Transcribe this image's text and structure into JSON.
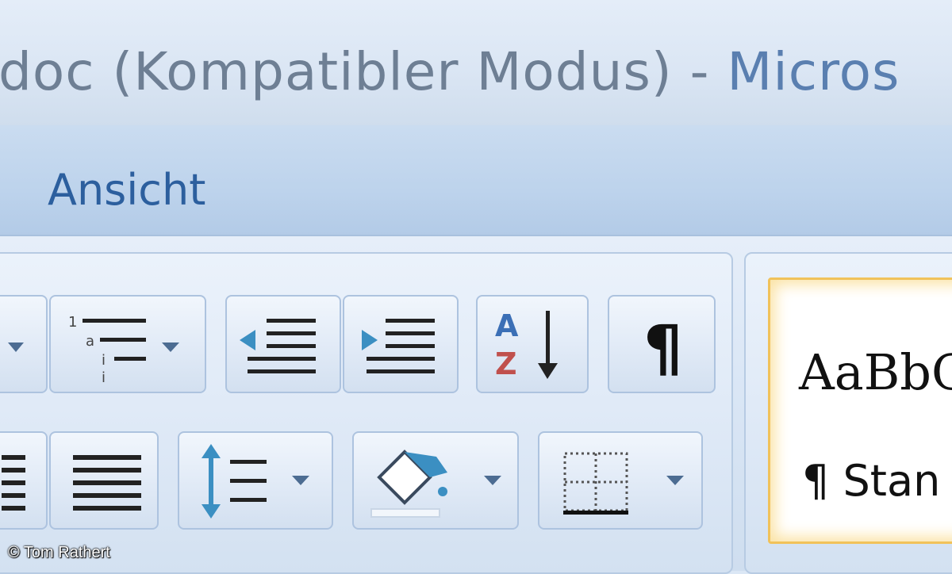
{
  "window": {
    "title_doc": "doc (Kompatibler Modus) - ",
    "title_app": "Micros"
  },
  "tabs": {
    "ansicht": "Ansicht"
  },
  "paragraph_group": {
    "buttons": [
      {
        "name": "bullets-dropdown",
        "icon": "chevron-down-icon"
      },
      {
        "name": "multilevel-list",
        "icon": "multilevel-list-icon"
      },
      {
        "name": "decrease-indent",
        "icon": "decrease-indent-icon"
      },
      {
        "name": "increase-indent",
        "icon": "increase-indent-icon"
      },
      {
        "name": "sort",
        "icon": "sort-az-icon",
        "letters": [
          "A",
          "Z"
        ]
      },
      {
        "name": "show-formatting-marks",
        "icon": "pilcrow-icon",
        "glyph": "¶"
      },
      {
        "name": "align-right",
        "icon": "align-right-icon"
      },
      {
        "name": "justify",
        "icon": "justify-icon"
      },
      {
        "name": "line-spacing",
        "icon": "line-spacing-icon"
      },
      {
        "name": "shading",
        "icon": "paint-bucket-icon"
      },
      {
        "name": "borders",
        "icon": "borders-icon"
      }
    ]
  },
  "styles_group": {
    "preview_text": "AaBb",
    "preview_tail": "C",
    "style_label": "¶ Stan"
  },
  "colors": {
    "accent": "#2c5f9e",
    "title_gray": "#6e7f94",
    "highlight_border": "#f1c25a",
    "sort_a": "#3b6fb6",
    "sort_z": "#c0504d"
  },
  "credit": "© Tom Rathert"
}
